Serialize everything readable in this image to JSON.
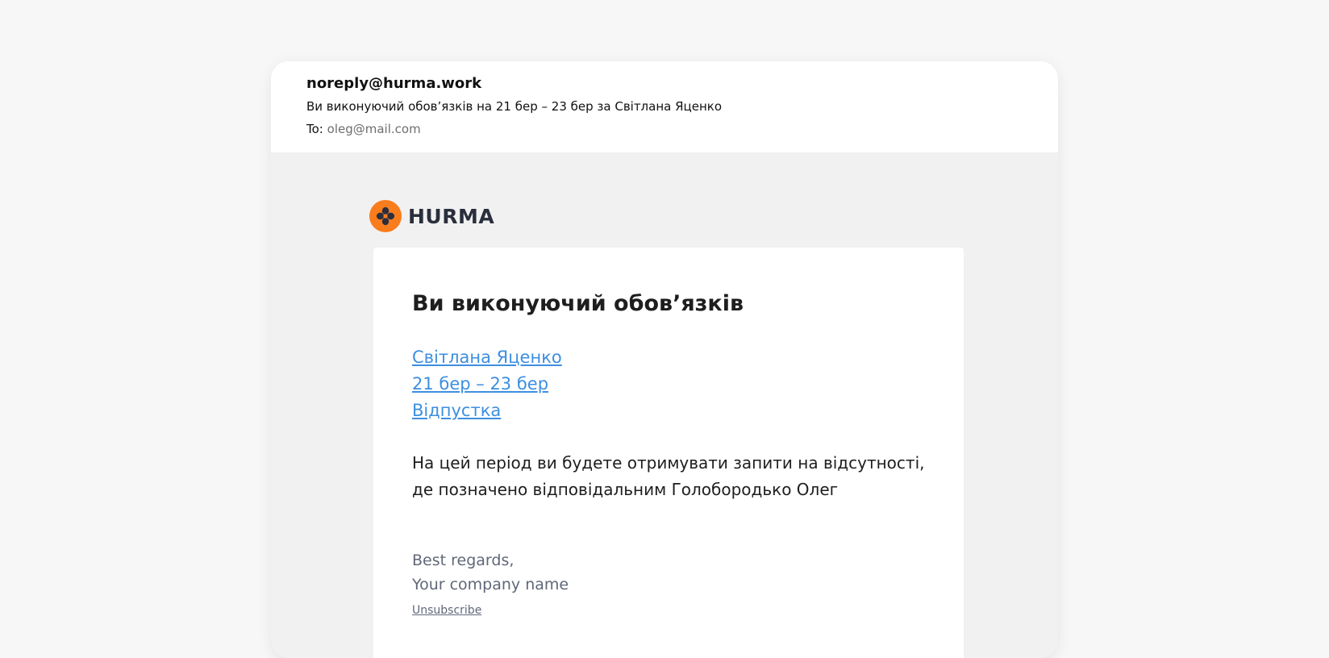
{
  "email": {
    "from": "noreply@hurma.work",
    "subject": "Ви виконуючий обов’язків на 21 бер – 23 бер за Світлана Яценко",
    "to_label": "To:",
    "to_address": "oleg@mail.com"
  },
  "logo": {
    "text": "HURMA",
    "accent_color": "#f97c1d"
  },
  "card": {
    "title": "Ви виконуючий обов’язків",
    "links": {
      "person": "Світлана Яценко",
      "period": "21 бер – 23 бер",
      "type": "Відпустка"
    },
    "body_line1": "На цей період ви будете отримувати запити на відсутності,",
    "body_line2": "де позначено відповідальним Голобородько Олег",
    "signature_line1": "Best regards,",
    "signature_line2": "Your company name",
    "unsubscribe": "Unsubscribe"
  },
  "colors": {
    "link": "#3d8fe0",
    "muted_text": "#606778",
    "logo_text": "#2a2f3d"
  }
}
